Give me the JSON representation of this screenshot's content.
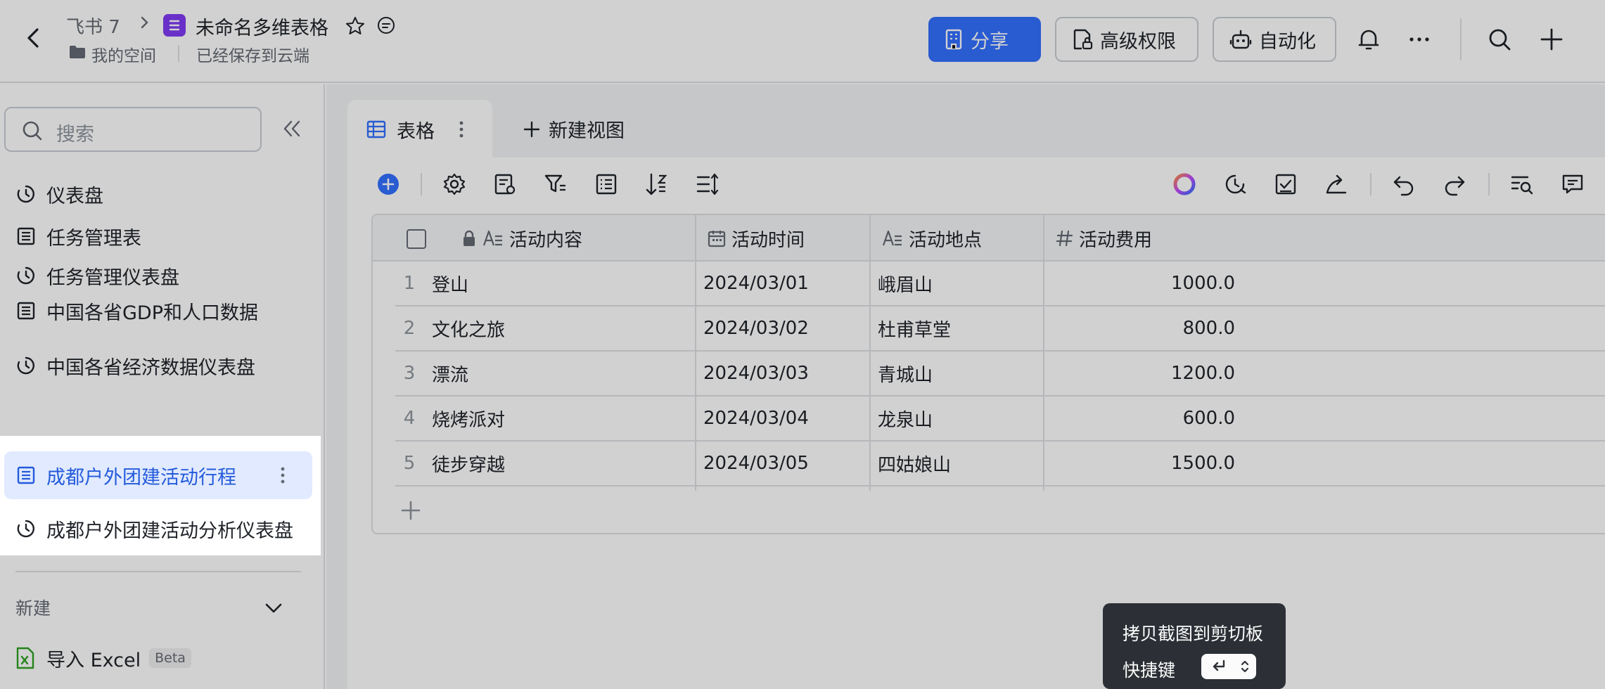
{
  "header": {
    "app_name": "飞书 7",
    "doc_title": "未命名多维表格",
    "space": "我的空间",
    "save_status": "已经保存到云端",
    "share_label": "分享",
    "advanced_label": "高级权限",
    "automation_label": "自动化"
  },
  "sidebar": {
    "search_placeholder": "搜索",
    "items": [
      {
        "label": "仪表盘",
        "icon": "dashboard-icon"
      },
      {
        "label": "任务管理表",
        "icon": "table-icon"
      },
      {
        "label": "任务管理仪表盘",
        "icon": "dashboard-icon"
      },
      {
        "label": "中国各省GDP和人口数据",
        "icon": "table-icon"
      },
      {
        "label": "中国各省经济数据仪表盘",
        "icon": "dashboard-icon"
      },
      {
        "label": "成都户外团建活动行程",
        "icon": "table-icon",
        "active": true
      },
      {
        "label": "成都户外团建活动分析仪表盘",
        "icon": "dashboard-icon"
      }
    ],
    "new_label": "新建",
    "import_label": "导入 Excel",
    "import_badge": "Beta"
  },
  "view": {
    "tab_label": "表格",
    "new_view_label": "新建视图"
  },
  "table": {
    "columns": [
      {
        "label": "活动内容",
        "icon": "text-field-icon"
      },
      {
        "label": "活动时间",
        "icon": "date-field-icon"
      },
      {
        "label": "活动地点",
        "icon": "text-field-icon"
      },
      {
        "label": "活动费用",
        "icon": "number-field-icon"
      }
    ],
    "rows": [
      {
        "index": "1",
        "content": "登山",
        "date": "2024/03/01",
        "place": "峨眉山",
        "fee": "1000.0"
      },
      {
        "index": "2",
        "content": "文化之旅",
        "date": "2024/03/02",
        "place": "杜甫草堂",
        "fee": "800.0"
      },
      {
        "index": "3",
        "content": "漂流",
        "date": "2024/03/03",
        "place": "青城山",
        "fee": "1200.0"
      },
      {
        "index": "4",
        "content": "烧烤派对",
        "date": "2024/03/04",
        "place": "龙泉山",
        "fee": "600.0"
      },
      {
        "index": "5",
        "content": "徒步穿越",
        "date": "2024/03/05",
        "place": "四姑娘山",
        "fee": "1500.0"
      }
    ]
  },
  "tooltip": {
    "title": "拷贝截图到剪切板",
    "shortcut_label": "快捷键"
  },
  "colors": {
    "accent": "#3370ff",
    "active_text": "#245bdb"
  }
}
